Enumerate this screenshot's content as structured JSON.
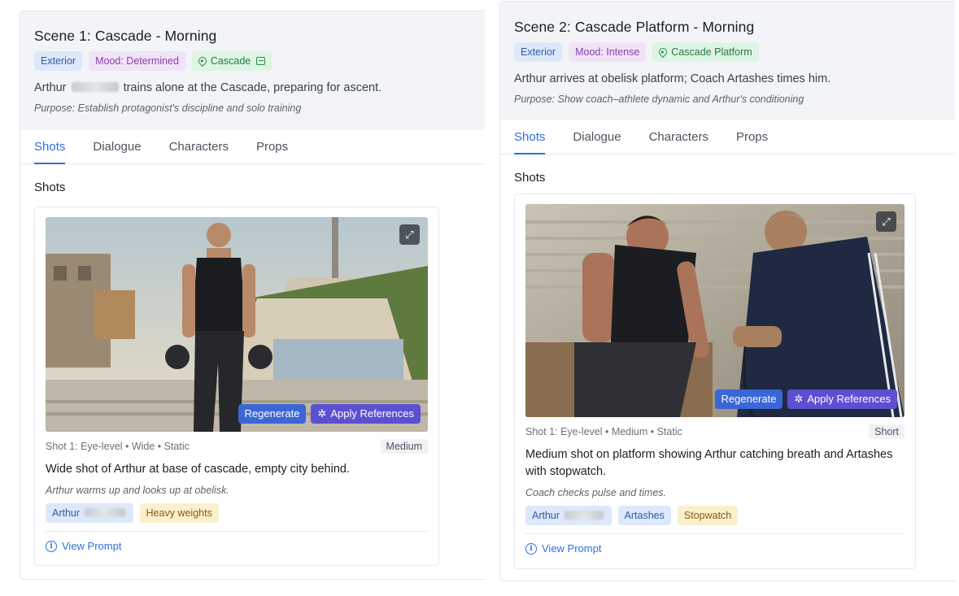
{
  "scenes": [
    {
      "title": "Scene 1: Cascade - Morning",
      "tags": {
        "setting": "Exterior",
        "mood": "Mood: Determined",
        "location": "Cascade"
      },
      "description_prefix": "Arthur",
      "description_suffix": "trains alone at the Cascade, preparing for ascent.",
      "purpose": "Purpose: Establish protagonist's discipline and solo training",
      "tabs": [
        "Shots",
        "Dialogue",
        "Characters",
        "Props"
      ],
      "section_title": "Shots",
      "shot": {
        "meta": "Shot 1: Eye-level • Wide • Static",
        "badge": "Medium",
        "description": "Wide shot of Arthur at base of cascade, empty city behind.",
        "note": "Arthur warms up and looks up at obelisk.",
        "characters": [
          "Arthur"
        ],
        "props": [
          "Heavy weights"
        ],
        "regenerate": "Regenerate",
        "apply": "Apply References",
        "view_prompt": "View Prompt"
      }
    },
    {
      "title": "Scene 2: Cascade Platform - Morning",
      "tags": {
        "setting": "Exterior",
        "mood": "Mood: Intense",
        "location": "Cascade Platform"
      },
      "description": "Arthur arrives at obelisk platform; Coach Artashes times him.",
      "purpose": "Purpose: Show coach–athlete dynamic and Arthur's conditioning",
      "tabs": [
        "Shots",
        "Dialogue",
        "Characters",
        "Props"
      ],
      "section_title": "Shots",
      "shot": {
        "meta": "Shot 1: Eye-level • Medium • Static",
        "badge": "Short",
        "description": "Medium shot on platform showing Arthur catching breath and Artashes with stopwatch.",
        "note": "Coach checks pulse and times.",
        "characters": [
          "Arthur",
          "Artashes"
        ],
        "props": [
          "Stopwatch"
        ],
        "regenerate": "Regenerate",
        "apply": "Apply References",
        "view_prompt": "View Prompt"
      }
    }
  ],
  "icons": {
    "location": "map-pin-icon",
    "image": "image-icon",
    "expand": "expand-icon",
    "sparkle": "sparkle-icon",
    "info": "info-icon"
  },
  "colors": {
    "accent": "#2f6fe0",
    "regenerate": "#3b66d6",
    "apply": "#5d4fd1",
    "header_bg": "#f2f4f7"
  }
}
